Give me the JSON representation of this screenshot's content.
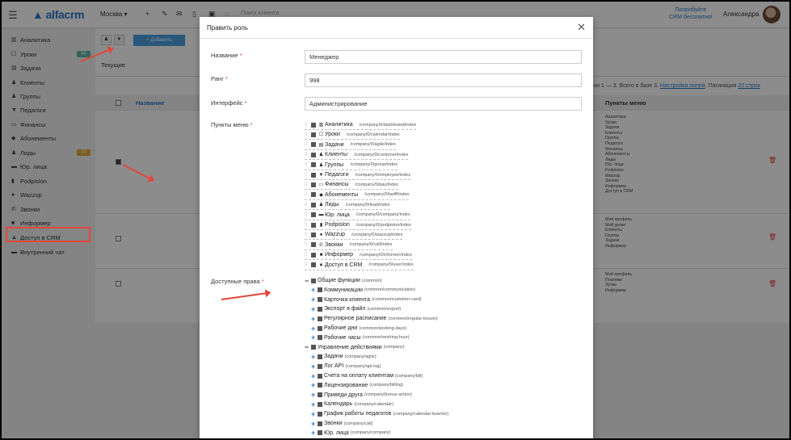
{
  "topbar": {
    "logo": "alfacrm",
    "branch": "Москва ▾",
    "search_placeholder": "Поиск клиента",
    "promo_line1": "Попробуйте",
    "promo_line2": "CRM бесплатно!",
    "username": "Александра"
  },
  "sidebar": {
    "items": [
      {
        "label": "Аналитика",
        "icon": "chart-icon",
        "glyph": "▥"
      },
      {
        "label": "Уроки",
        "icon": "calendar-icon",
        "glyph": "☐",
        "badge": "45",
        "badge_color": "#5fb8a0"
      },
      {
        "label": "Задачи",
        "icon": "tasks-icon",
        "glyph": "▤"
      },
      {
        "label": "Клиенты",
        "icon": "user-icon",
        "glyph": "♟"
      },
      {
        "label": "Группы",
        "icon": "users-icon",
        "glyph": "♟"
      },
      {
        "label": "Педагоги",
        "icon": "graduation-icon",
        "glyph": "▼"
      },
      {
        "label": "Финансы",
        "icon": "money-icon",
        "glyph": "▭"
      },
      {
        "label": "Абонементы",
        "icon": "tag-icon",
        "glyph": "◆"
      },
      {
        "label": "Лиды",
        "icon": "lead-icon",
        "glyph": "♟",
        "badge": "20",
        "badge_color": "#e0a93b"
      },
      {
        "label": "Юр. лица",
        "icon": "bus-icon",
        "glyph": "▬"
      },
      {
        "label": "Podpislon",
        "icon": "file-icon",
        "glyph": "▮"
      },
      {
        "label": "Wazzup",
        "icon": "whatsapp-icon",
        "glyph": "●"
      },
      {
        "label": "Звонки",
        "icon": "phone-icon",
        "glyph": "✆"
      },
      {
        "label": "Информер",
        "icon": "bookmark-icon",
        "glyph": "■"
      },
      {
        "label": "Доступ в CRM",
        "icon": "lock-icon",
        "glyph": "▲"
      },
      {
        "label": "Внутренний чат",
        "icon": "chat-icon",
        "glyph": "▬"
      }
    ]
  },
  "main": {
    "add_button": "+ Добавить",
    "tab_current": "Текущие",
    "col_name": "Название",
    "col_menu": "Пункты меню",
    "pager_prefix": "ки 1 — 3. Всего в базе 3.",
    "pager_settings": "Настройка полей",
    "pager_pagination": "Пагинация",
    "pager_count": "20 строк",
    "rows": [
      {
        "menu": [
          "Аналитика",
          "Уроки",
          "Задачи",
          "Клиенты",
          "Группы",
          "Педагоги",
          "Финансы",
          "Абонементы",
          "Лиды",
          "Юр. лица",
          "Podpislon",
          "Wazzup",
          "Звонки",
          "Информер",
          "Доступ в CRM"
        ]
      },
      {
        "menu": [
          "Мой профиль",
          "Мой уроки",
          "Клиенты",
          "Группы",
          "Задачи",
          "Информер"
        ]
      },
      {
        "menu": [
          "Мой профиль",
          "Платежи",
          "Уроки",
          "Информер"
        ]
      }
    ]
  },
  "modal": {
    "title": "Править роль",
    "fields": {
      "name_label": "Название",
      "name_value": "Менеджер",
      "rank_label": "Ранг",
      "rank_value": "998",
      "interface_label": "Интерфейс",
      "interface_value": "Администрирование",
      "menu_label": "Пункты меню",
      "rights_label": "Доступные права"
    },
    "menu_items": [
      {
        "label": "Аналитика",
        "path": "/company/0/dashboard/index",
        "glyph": "▥"
      },
      {
        "label": "Уроки",
        "path": "/company/0/calendar/index",
        "glyph": "☐"
      },
      {
        "label": "Задачи",
        "path": "/company/0/agile/index",
        "glyph": "▤"
      },
      {
        "label": "Клиенты",
        "path": "/company/0/customer/index",
        "glyph": "♟"
      },
      {
        "label": "Группы",
        "path": "/company/0/group/index",
        "glyph": "♟"
      },
      {
        "label": "Педагоги",
        "path": "/company/0/employee/index",
        "glyph": "▼"
      },
      {
        "label": "Финансы",
        "path": "/company/0/pay/index",
        "glyph": "▭"
      },
      {
        "label": "Абонементы",
        "path": "/company/0/tariff/index",
        "glyph": "◆"
      },
      {
        "label": "Лиды",
        "path": "/company/0/lead/index",
        "glyph": "♟"
      },
      {
        "label": "Юр. лица",
        "path": "/company/0/company/index",
        "glyph": "▬"
      },
      {
        "label": "Podpislon",
        "path": "/company/0/podpislon/index",
        "glyph": "▮"
      },
      {
        "label": "Wazzup",
        "path": "/company/0/wazzup/index",
        "glyph": "●"
      },
      {
        "label": "Звонки",
        "path": "/company/0/call/index",
        "glyph": "✆"
      },
      {
        "label": "Информер",
        "path": "/company/0/informer/index",
        "glyph": "■"
      },
      {
        "label": "Доступ в CRM",
        "path": "/company/0/user/index",
        "glyph": "▲"
      }
    ],
    "rights": [
      {
        "label": "Общие функции",
        "code": "(common)",
        "level": 0
      },
      {
        "label": "Коммуникации",
        "code": "(common/communication)",
        "level": 1
      },
      {
        "label": "Карточка клиента",
        "code": "(common/customer-card)",
        "level": 1
      },
      {
        "label": "Экспорт в файл",
        "code": "(common/export)",
        "level": 1
      },
      {
        "label": "Регулярное расписание",
        "code": "(common/regular-lesson)",
        "level": 1
      },
      {
        "label": "Рабочие дни",
        "code": "(common/working-days)",
        "level": 1
      },
      {
        "label": "Рабочие часы",
        "code": "(common/working-hour)",
        "level": 1
      },
      {
        "label": "Управление действиями",
        "code": "(company)",
        "level": 0
      },
      {
        "label": "Задачи",
        "code": "(company/agile)",
        "level": 1
      },
      {
        "label": "Лог API",
        "code": "(company/api-log)",
        "level": 1
      },
      {
        "label": "Счета на оплату клиентам",
        "code": "(company/bill)",
        "level": 1
      },
      {
        "label": "Лицензирование",
        "code": "(company/billing)",
        "level": 1
      },
      {
        "label": "Приведи друга",
        "code": "(company/bonus-action)",
        "level": 1
      },
      {
        "label": "Календарь",
        "code": "(company/calendar)",
        "level": 1
      },
      {
        "label": "График работы педагогов",
        "code": "(company/calendar-teacher)",
        "level": 1
      },
      {
        "label": "Звонки",
        "code": "(company/call)",
        "level": 1
      },
      {
        "label": "Юр. лица",
        "code": "(company/company)",
        "level": 1
      }
    ]
  },
  "colors": {
    "accent": "#2a78c7",
    "danger": "#e3473c",
    "button": "#4a9fe0"
  }
}
